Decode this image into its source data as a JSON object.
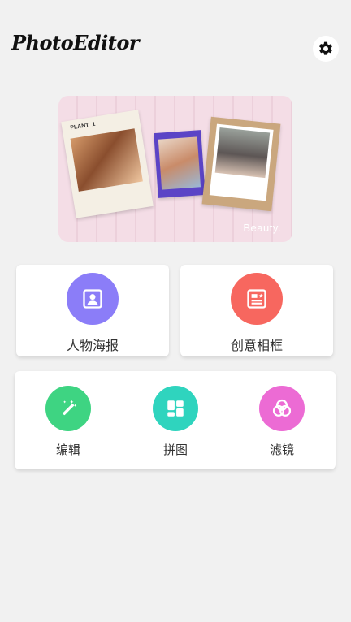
{
  "header": {
    "title": "PhotoEditor",
    "settings_icon": "gear-icon"
  },
  "banner": {
    "caption": "Beauty.",
    "photo_label": "PLANT_1"
  },
  "features": [
    {
      "label": "人物海报",
      "icon": "portrait-icon",
      "color": "#8b7df8"
    },
    {
      "label": "创意相框",
      "icon": "frame-icon",
      "color": "#f7675f"
    }
  ],
  "tools": [
    {
      "label": "编辑",
      "icon": "magic-wand-icon",
      "color": "#3ed482"
    },
    {
      "label": "拼图",
      "icon": "collage-icon",
      "color": "#2fd4be"
    },
    {
      "label": "滤镜",
      "icon": "filter-icon",
      "color": "#ec6bd4"
    }
  ]
}
